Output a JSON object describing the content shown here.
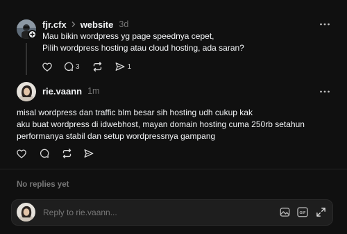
{
  "post": {
    "username": "fjr.cfx",
    "separator_icon": "chevron-right-icon",
    "community": "website",
    "time": "3d",
    "more_icon": "more-dots-icon",
    "text": "Mau bikin wordpress yg page speednya cepet,\nPilih wordpress hosting atau cloud hosting, ada saran?",
    "actions": {
      "like_icon": "heart-icon",
      "comment_icon": "comment-icon",
      "comment_count": "3",
      "repost_icon": "repost-icon",
      "share_icon": "share-icon",
      "share_count": "1"
    }
  },
  "reply": {
    "username": "rie.vaann",
    "time": "1m",
    "text": "misal wordpress dan traffic blm besar sih hosting udh cukup kak\naku buat wordpress di idwebhost, mayan domain hosting cuma 250rb setahun\nperformanya stabil dan setup wordpressnya gampang"
  },
  "no_replies": "No replies yet",
  "composer": {
    "placeholder": "Reply to rie.vaann...",
    "icons": [
      "image-icon",
      "gif-icon",
      "expand-icon"
    ]
  },
  "colors": {
    "background": "#101010",
    "text": "#f3f5f7",
    "muted": "#777777",
    "composer_bg": "#1e1e1e"
  }
}
